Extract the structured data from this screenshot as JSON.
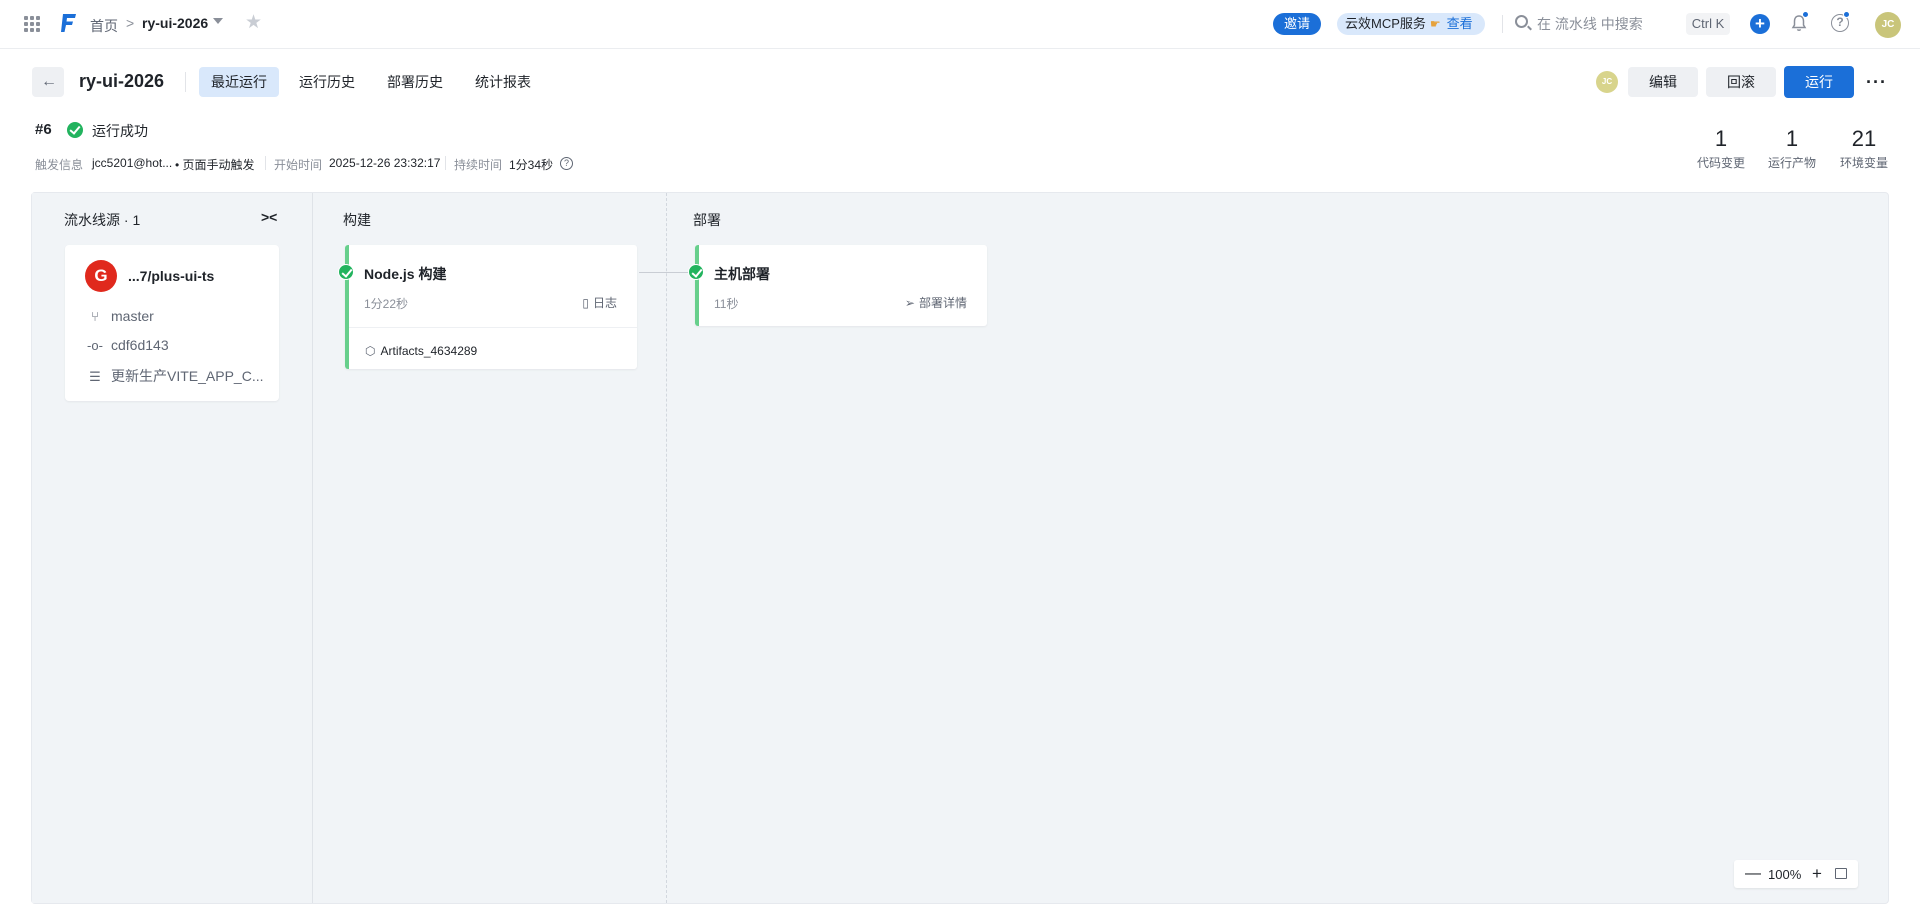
{
  "nav": {
    "home": "首页",
    "separator": ">",
    "project": "ry-ui-2026",
    "invite": "邀请",
    "mcp_label": "云效MCP服务",
    "mcp_link": "查看",
    "search_placeholder": "在 流水线 中搜索",
    "shortcut": "Ctrl K",
    "avatar": "JC"
  },
  "header": {
    "title": "ry-ui-2026",
    "tabs": [
      {
        "label": "最近运行",
        "active": true
      },
      {
        "label": "运行历史",
        "active": false
      },
      {
        "label": "部署历史",
        "active": false
      },
      {
        "label": "统计报表",
        "active": false
      }
    ],
    "avatar": "JC",
    "edit": "编辑",
    "rollback": "回滚",
    "run": "运行"
  },
  "run": {
    "number": "#6",
    "status": "运行成功",
    "trigger_label": "触发信息",
    "trigger_user": "jcc5201@hot...",
    "trigger_type": "• 页面手动触发",
    "start_label": "开始时间",
    "start_time": "2025-12-26 23:32:17",
    "duration_label": "持续时间",
    "duration": "1分34秒"
  },
  "stats": [
    {
      "value": "1",
      "label": "代码变更"
    },
    {
      "value": "1",
      "label": "运行产物"
    },
    {
      "value": "21",
      "label": "环境变量"
    }
  ],
  "pipeline": {
    "source_header": "流水线源 · 1",
    "source": {
      "repo_letter": "G",
      "repo": "...7/plus-ui-ts",
      "branch": "master",
      "commit": "cdf6d143",
      "message": "更新生产VITE_APP_C..."
    },
    "stages": [
      {
        "name": "构建",
        "job": {
          "title": "Node.js 构建",
          "time": "1分22秒",
          "link": "日志",
          "artifact": "Artifacts_4634289"
        }
      },
      {
        "name": "部署",
        "job": {
          "title": "主机部署",
          "time": "11秒",
          "link": "部署详情"
        }
      }
    ],
    "zoom": "100%"
  },
  "colors": {
    "primary": "#1b6fd8",
    "success": "#22b35e",
    "stage_bar": "#67cf8c",
    "repo": "#e0291d",
    "canvas": "#f1f4f7"
  }
}
